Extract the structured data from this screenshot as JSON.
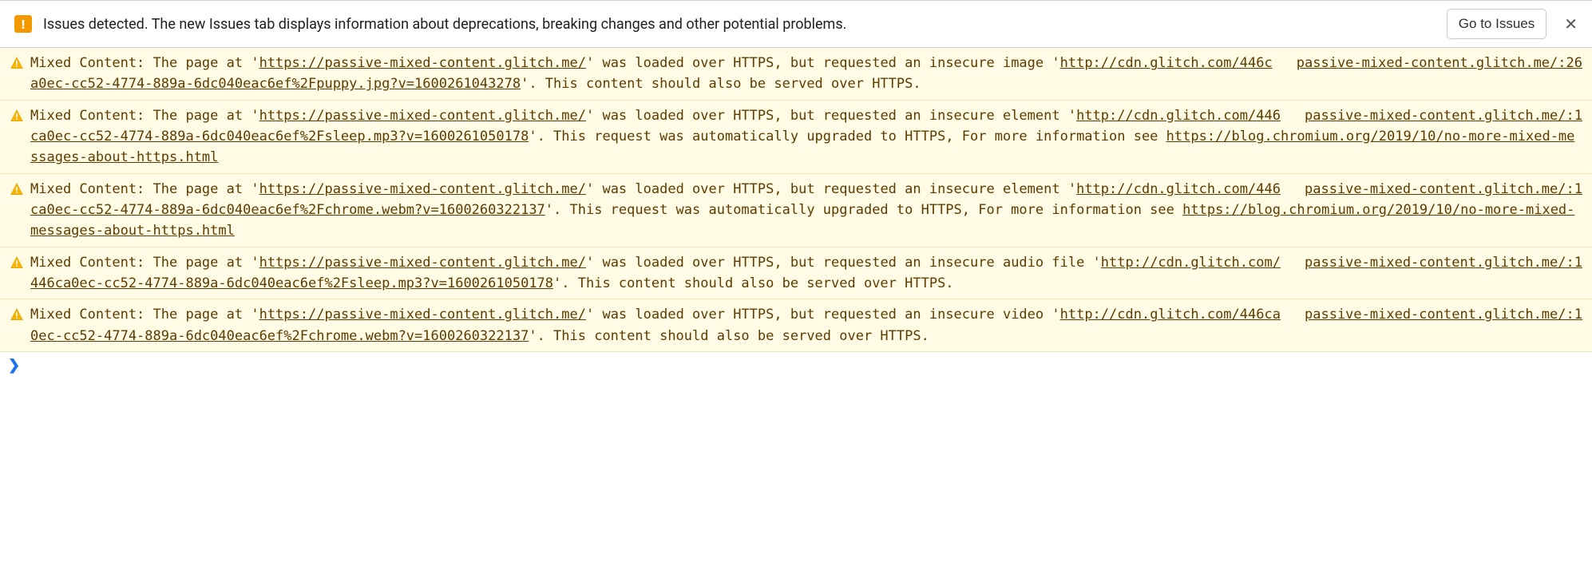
{
  "banner": {
    "text": "Issues detected. The new Issues tab displays information about deprecations, breaking changes and other potential problems.",
    "button": "Go to Issues",
    "close": "✕"
  },
  "messages": [
    {
      "source": "passive-mixed-content.glitch.me/:26",
      "parts": [
        {
          "t": "text",
          "v": "Mixed Content: The page at '"
        },
        {
          "t": "link",
          "v": "https://passive-mixed-content.glitch.me/"
        },
        {
          "t": "text",
          "v": "' was loaded over HTTPS, but requested an insecure image '"
        },
        {
          "t": "link",
          "v": "http://cdn.glitch.com/446ca0ec-cc52-4774-889a-6dc040eac6ef%2Fpuppy.jpg?v=1600261043278"
        },
        {
          "t": "text",
          "v": "'. This content should also be served over HTTPS."
        }
      ]
    },
    {
      "source": "passive-mixed-content.glitch.me/:1",
      "parts": [
        {
          "t": "text",
          "v": "Mixed Content: The page at '"
        },
        {
          "t": "link",
          "v": "https://passive-mixed-content.glitch.me/"
        },
        {
          "t": "text",
          "v": "' was loaded over HTTPS, but requested an insecure element '"
        },
        {
          "t": "link",
          "v": "http://cdn.glitch.com/446ca0ec-cc52-4774-889a-6dc040eac6ef%2Fsleep.mp3?v=1600261050178"
        },
        {
          "t": "text",
          "v": "'. This request was automatically upgraded to HTTPS, For more information see "
        },
        {
          "t": "link",
          "v": "https://blog.chromium.org/2019/10/no-more-mixed-messages-about-https.html"
        }
      ]
    },
    {
      "source": "passive-mixed-content.glitch.me/:1",
      "parts": [
        {
          "t": "text",
          "v": "Mixed Content: The page at '"
        },
        {
          "t": "link",
          "v": "https://passive-mixed-content.glitch.me/"
        },
        {
          "t": "text",
          "v": "' was loaded over HTTPS, but requested an insecure element '"
        },
        {
          "t": "link",
          "v": "http://cdn.glitch.com/446ca0ec-cc52-4774-889a-6dc040eac6ef%2Fchrome.webm?v=1600260322137"
        },
        {
          "t": "text",
          "v": "'. This request was automatically upgraded to HTTPS, For more information see "
        },
        {
          "t": "link",
          "v": "https://blog.chromium.org/2019/10/no-more-mixed-messages-about-https.html"
        }
      ]
    },
    {
      "source": "passive-mixed-content.glitch.me/:1",
      "parts": [
        {
          "t": "text",
          "v": "Mixed Content: The page at '"
        },
        {
          "t": "link",
          "v": "https://passive-mixed-content.glitch.me/"
        },
        {
          "t": "text",
          "v": "' was loaded over HTTPS, but requested an insecure audio file '"
        },
        {
          "t": "link",
          "v": "http://cdn.glitch.com/446ca0ec-cc52-4774-889a-6dc040eac6ef%2Fsleep.mp3?v=1600261050178"
        },
        {
          "t": "text",
          "v": "'. This content should also be served over HTTPS."
        }
      ]
    },
    {
      "source": "passive-mixed-content.glitch.me/:1",
      "parts": [
        {
          "t": "text",
          "v": "Mixed Content: The page at '"
        },
        {
          "t": "link",
          "v": "https://passive-mixed-content.glitch.me/"
        },
        {
          "t": "text",
          "v": "' was loaded over HTTPS, but requested an insecure video '"
        },
        {
          "t": "link",
          "v": "http://cdn.glitch.com/446ca0ec-cc52-4774-889a-6dc040eac6ef%2Fchrome.webm?v=1600260322137"
        },
        {
          "t": "text",
          "v": "'. This content should also be served over HTTPS."
        }
      ]
    }
  ],
  "prompt": "❯"
}
